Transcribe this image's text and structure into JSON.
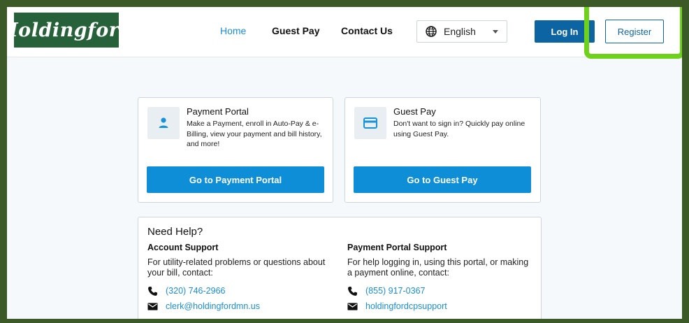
{
  "brand": {
    "logo_text": "Holdingford",
    "logo_color": "#27613a"
  },
  "nav": {
    "home": "Home",
    "guest_pay": "Guest Pay",
    "contact_us": "Contact Us"
  },
  "language": {
    "selected": "English",
    "icon": "globe-icon"
  },
  "auth": {
    "login_label": "Log In",
    "register_label": "Register"
  },
  "colors": {
    "primary": "#0c64a3",
    "accent": "#0f8ed8",
    "link": "#1a8fd3",
    "frame": "#3b5a28",
    "highlight": "#6ed21a"
  },
  "cards": [
    {
      "icon": "person-icon",
      "title": "Payment Portal",
      "description": "Make a Payment, enroll in Auto-Pay & e-Billing, view your payment and bill history, and more!",
      "button": "Go to Payment Portal"
    },
    {
      "icon": "credit-card-icon",
      "title": "Guest Pay",
      "description": "Don't want to sign in? Quickly pay online using Guest Pay.",
      "button": "Go to Guest Pay"
    }
  ],
  "help": {
    "title": "Need Help?",
    "account": {
      "heading": "Account Support",
      "text": "For utility-related problems or questions about your bill, contact:",
      "phone": "(320) 746-2966",
      "email": "clerk@holdingfordmn.us"
    },
    "portal": {
      "heading": "Payment Portal Support",
      "text": "For help logging in, using this portal, or making a payment online, contact:",
      "phone": "(855) 917-0367",
      "email": "holdingfordcpsupport"
    }
  }
}
